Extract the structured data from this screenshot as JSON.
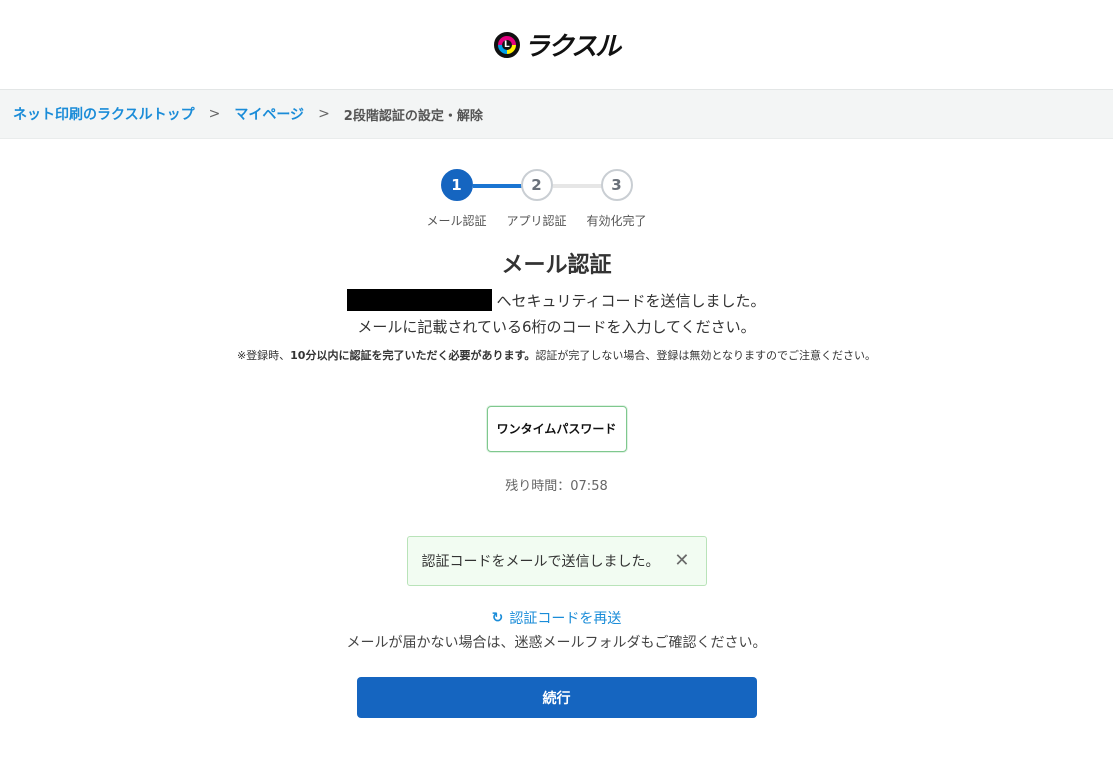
{
  "header": {
    "logo_text": "ラクスル",
    "logo_mark_text": "L"
  },
  "breadcrumb": {
    "items": [
      {
        "label": "ネット印刷のラクスルトップ"
      },
      {
        "label": "マイページ"
      },
      {
        "label": "2段階認証の設定・解除"
      }
    ],
    "separator": ">"
  },
  "stepper": {
    "steps": [
      {
        "number": "1",
        "label": "メール認証",
        "state": "active"
      },
      {
        "number": "2",
        "label": "アプリ認証",
        "state": "inactive"
      },
      {
        "number": "3",
        "label": "有効化完了",
        "state": "inactive"
      }
    ]
  },
  "main": {
    "title": "メール認証",
    "sent_suffix": "へセキュリティコードを送信しました。",
    "instruction": "メールに記載されている6桁のコードを入力してください。",
    "notice_prefix": "※登録時、",
    "notice_bold": "10分以内に認証を完了いただく必要があります。",
    "notice_suffix": "認証が完了しない場合、登録は無効となりますのでご注意ください。",
    "otp_placeholder": "ワンタイムパスワード",
    "timer": "残り時間：07:58",
    "toast_message": "認証コードをメールで送信しました。",
    "toast_close": "✕",
    "resend_icon": "↻",
    "resend_label": "認証コードを再送",
    "hint": "メールが届かない場合は、迷惑メールフォルダもご確認ください。",
    "continue_label": "続行"
  },
  "colors": {
    "primary": "#1565c0",
    "link": "#1a8cd8",
    "toast_bg": "#f2fcf2",
    "toast_border": "#b9e3b9"
  }
}
